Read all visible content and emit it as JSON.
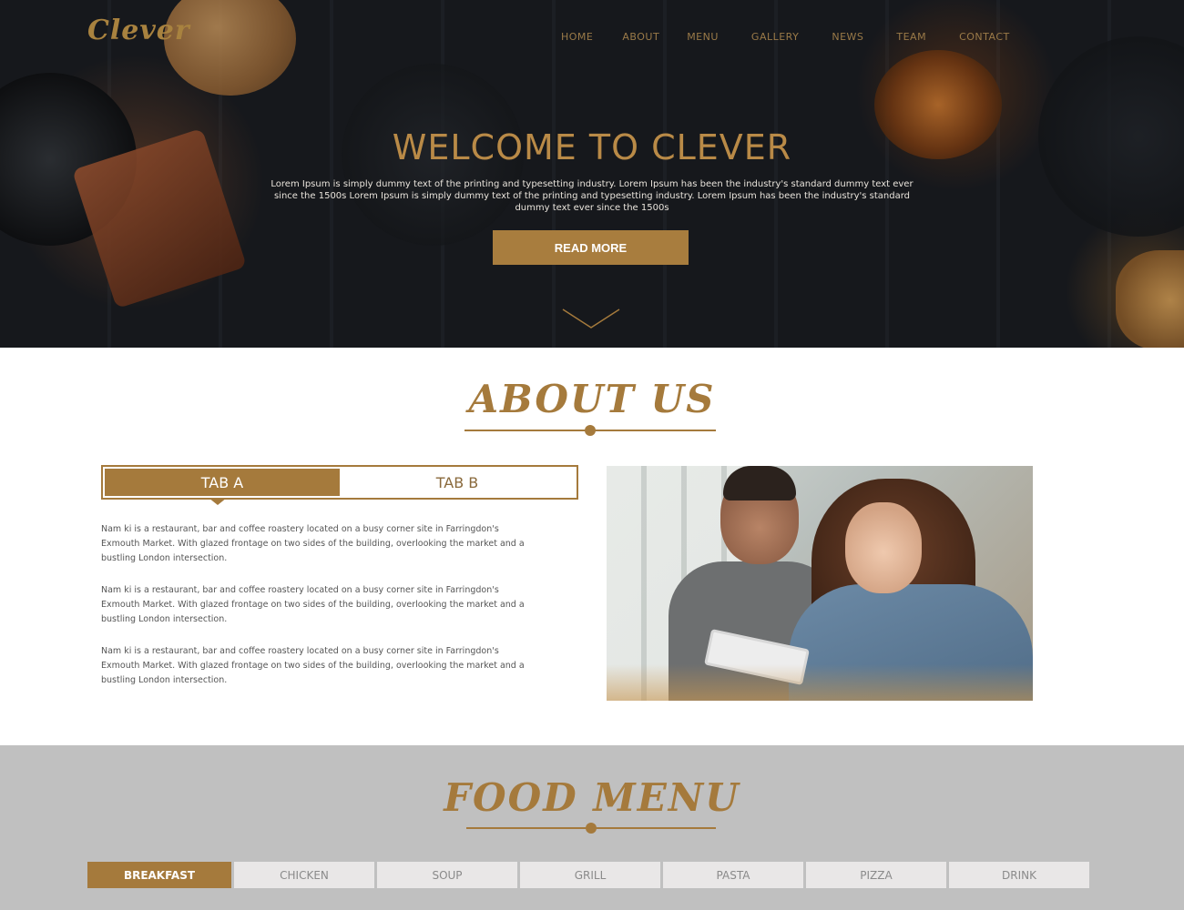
{
  "header": {
    "logo": "Clever",
    "nav": [
      "HOME",
      "ABOUT",
      "MENU",
      "GALLERY",
      "NEWS",
      "TEAM",
      "CONTACT"
    ]
  },
  "hero": {
    "title": "WELCOME TO CLEVER",
    "text": "Lorem Ipsum is simply dummy text of the printing and typesetting industry. Lorem Ipsum has been the industry's standard dummy text ever since the 1500s Lorem Ipsum is simply dummy text of the printing and typesetting industry. Lorem Ipsum has been the industry's standard dummy text ever since the 1500s",
    "button": "READ MORE",
    "scroll_icon": "chevron-down-icon"
  },
  "about": {
    "title": "ABOUT US",
    "tabs": [
      "TAB A",
      "TAB B"
    ],
    "active_tab": 0,
    "paragraphs": [
      "Nam ki is a restaurant, bar and coffee roastery located on a busy corner site in Farringdon's Exmouth Market. With glazed frontage on two sides of the building, overlooking the market and a bustling London intersection.",
      "Nam ki is a restaurant, bar and coffee roastery located on a busy corner site in Farringdon's Exmouth Market. With glazed frontage on two sides of the building, overlooking the market and a bustling London intersection.",
      "Nam ki is a restaurant, bar and coffee roastery located on a busy corner site in Farringdon's Exmouth Market. With glazed frontage on two sides of the building, overlooking the market and a bustling London intersection."
    ]
  },
  "food_menu": {
    "title": "FOOD MENU",
    "tabs": [
      "BREAKFAST",
      "CHICKEN",
      "SOUP",
      "GRILL",
      "PASTA",
      "PIZZA",
      "DRINK"
    ],
    "active_tab": 0
  },
  "colors": {
    "accent": "#a57a3c",
    "hero_bg": "#15171b",
    "menu_bg": "#c0c0c0"
  }
}
